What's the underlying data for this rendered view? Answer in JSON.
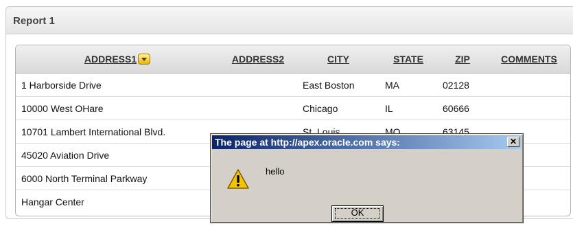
{
  "region": {
    "title": "Report 1"
  },
  "report": {
    "columns": [
      "ADDRESS1",
      "ADDRESS2",
      "CITY",
      "STATE",
      "ZIP",
      "COMMENTS"
    ],
    "rows": [
      [
        "1 Harborside Drive",
        "",
        "East Boston",
        "MA",
        "02128",
        ""
      ],
      [
        "10000 West OHare",
        "",
        "Chicago",
        "IL",
        "60666",
        ""
      ],
      [
        "10701 Lambert International Blvd.",
        "",
        "St. Louis",
        "MO",
        "63145",
        ""
      ],
      [
        "45020 Aviation Drive",
        "",
        "",
        "",
        "",
        ""
      ],
      [
        "6000 North Terminal Parkway",
        "",
        "",
        "",
        "",
        ""
      ],
      [
        "Hangar Center",
        "",
        "",
        "",
        "",
        ""
      ]
    ]
  },
  "dialog": {
    "title": "The page at http://apex.oracle.com says:",
    "message": "hello",
    "ok_label": "OK",
    "close_glyph": "✕",
    "icon": "warning-icon"
  },
  "colors": {
    "titlebar_start": "#0a246a",
    "titlebar_end": "#a6caf0",
    "dialog_face": "#d4d0c8",
    "warning": "#f5c400"
  }
}
